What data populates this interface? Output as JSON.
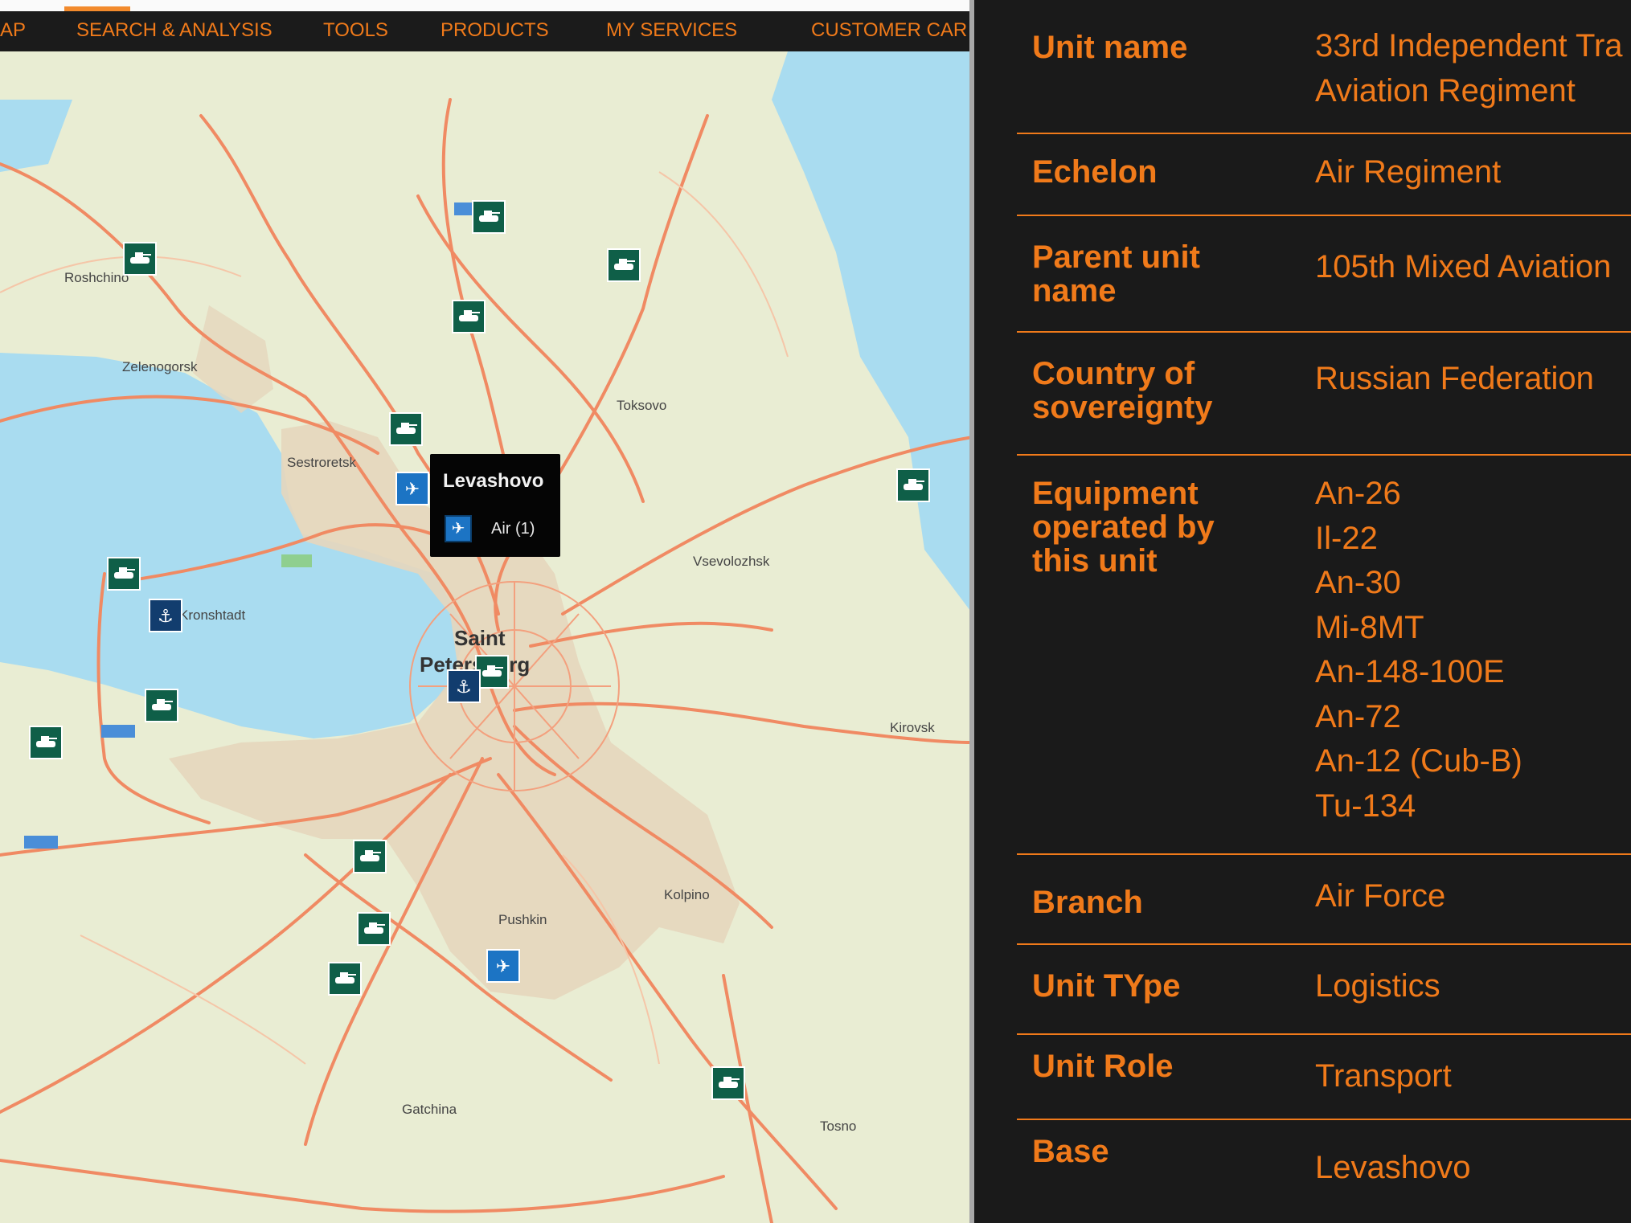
{
  "nav": {
    "items": [
      "AP",
      "SEARCH & ANALYSIS",
      "TOOLS",
      "PRODUCTS",
      "MY SERVICES",
      "CUSTOMER CAR"
    ]
  },
  "map": {
    "place_names": [
      "Roshchino",
      "Zelenogorsk",
      "Toksovo",
      "Sestroretsk",
      "Vsevolozhsk",
      "Kronshtadt",
      "Saint",
      "Petersburg",
      "Kirovsk",
      "Pushkin",
      "Kolpino",
      "Gatchina",
      "Tosno"
    ],
    "popup": {
      "title": "Levashovo",
      "category": "Air (1)"
    },
    "icons": {
      "ground": "tank-icon",
      "air": "aircraft-icon",
      "naval": "anchor-icon"
    },
    "colors": {
      "water": "#a9dcf0",
      "land": "#e9edd3",
      "urban": "#e5d6bd",
      "roads": "#f08a63",
      "ground_marker": "#0f5f48",
      "air_marker": "#1c74c4",
      "naval_marker": "#123d6e"
    }
  },
  "details": {
    "rows": [
      {
        "label": [
          "Unit name"
        ],
        "value": [
          "33rd Independent Tra",
          "Aviation Regiment"
        ]
      },
      {
        "label": [
          "Echelon"
        ],
        "value": [
          "Air Regiment"
        ]
      },
      {
        "label": [
          "Parent unit",
          "name"
        ],
        "value": [
          "105th Mixed Aviation"
        ]
      },
      {
        "label": [
          "Country of",
          "sovereignty"
        ],
        "value": [
          "Russian Federation"
        ]
      },
      {
        "label": [
          "Equipment",
          "operated by",
          "this unit"
        ],
        "value": [
          "An-26",
          "Il-22",
          "An-30",
          "Mi-8MT",
          "An-148-100E",
          "An-72",
          "An-12 (Cub-B)",
          "Tu-134"
        ]
      },
      {
        "label": [
          "Branch"
        ],
        "value": [
          "Air Force"
        ]
      },
      {
        "label": [
          "Unit TYpe"
        ],
        "value": [
          "Logistics"
        ]
      },
      {
        "label": [
          "Unit Role"
        ],
        "value": [
          "Transport"
        ]
      },
      {
        "label": [
          "Base"
        ],
        "value": [
          "Levashovo"
        ]
      }
    ],
    "accent_color": "#f07a1a",
    "background_color": "#1a1a1a"
  }
}
